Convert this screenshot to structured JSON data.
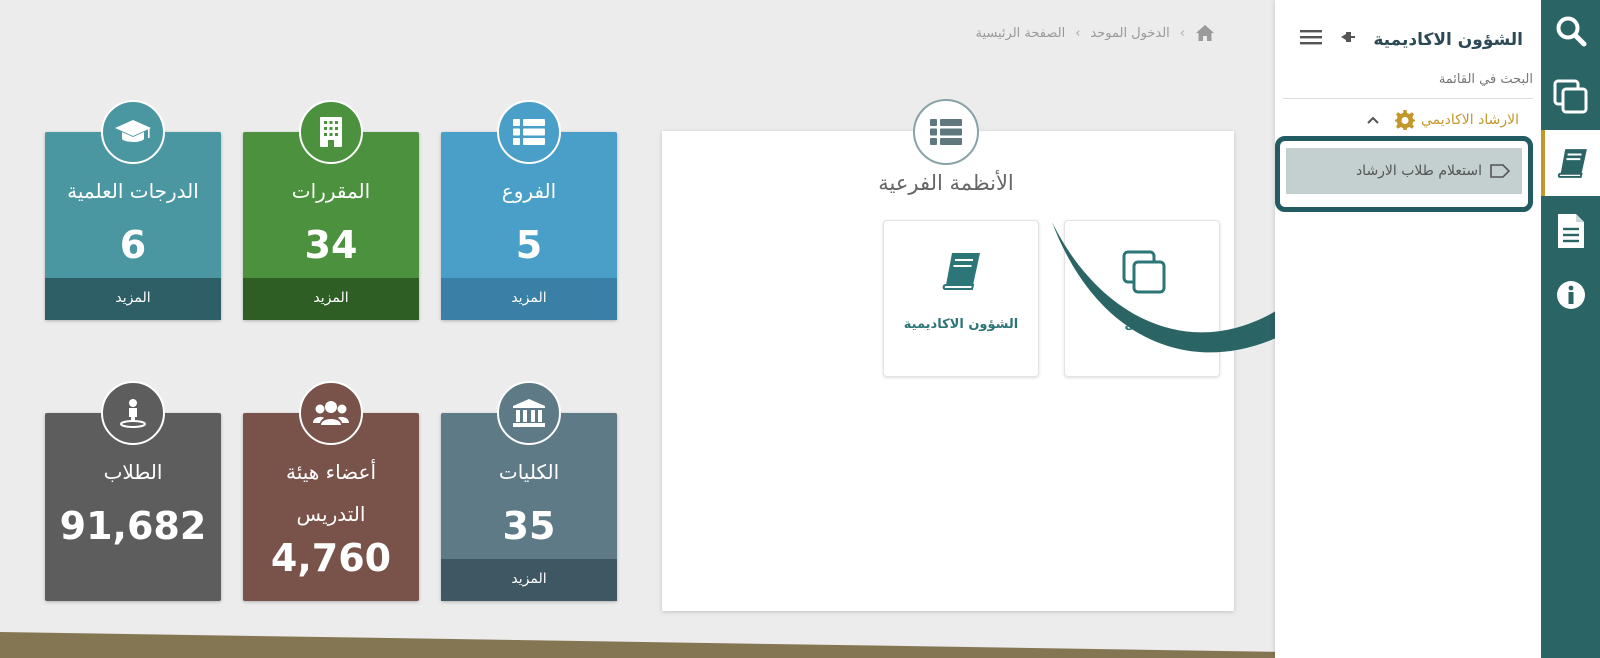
{
  "breadcrumb": {
    "home": "الصفحة الرئيسية",
    "current": "الدخول الموحد",
    "separator": "›"
  },
  "stats": [
    {
      "title": "الفروع",
      "value": "5",
      "more": "المزيد",
      "icon": "list-icon"
    },
    {
      "title": "المقررات",
      "value": "34",
      "more": "المزيد",
      "icon": "building-icon"
    },
    {
      "title": "الدرجات العلمية",
      "value": "6",
      "more": "المزيد",
      "icon": "graduation-cap-icon"
    },
    {
      "title": "الكليات",
      "value": "35",
      "more": "المزيد",
      "icon": "institution-icon"
    },
    {
      "title": "أعضاء هيئة التدريس",
      "value": "4,760",
      "icon": "users-icon"
    },
    {
      "title": "الطلاب",
      "value": "91,682",
      "icon": "student-icon"
    }
  ],
  "subsystems": {
    "title": "الأنظمة الفرعية",
    "tiles": [
      {
        "label": "الشؤون الاكاديمية",
        "icon": "book-icon"
      },
      {
        "label": "ـيل",
        "icon": "copy-icon"
      }
    ]
  },
  "side_menu": {
    "title": "الشؤون الاكاديمية",
    "search_label": "البحث في القائمة",
    "group_label": "الارشاد الاكاديمي",
    "sub_item_label": "استعلام طلاب الارشاد"
  },
  "icon_bar": [
    "search-icon",
    "copy-icon",
    "book-icon",
    "document-icon",
    "info-icon"
  ],
  "colors": {
    "branches": "#4a9fc9",
    "courses": "#4c913e",
    "degrees": "#4b97a1",
    "colleges": "#5e7a86",
    "faculty": "#79524a",
    "students": "#5d5d5d",
    "teal": "#2b6465",
    "gold": "#c2982c"
  }
}
